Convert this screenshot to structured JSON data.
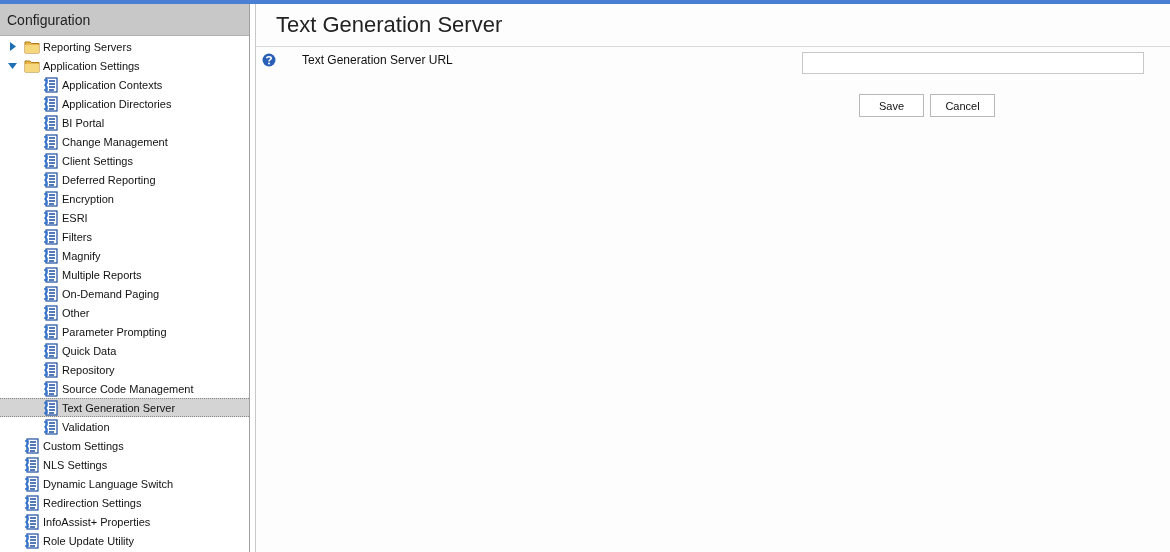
{
  "sidebar": {
    "title": "Configuration",
    "tree": [
      {
        "label": "Reporting Servers",
        "kind": "folder",
        "expanded": false,
        "selected": false
      },
      {
        "label": "Application Settings",
        "kind": "folder",
        "expanded": true,
        "selected": false,
        "children": [
          {
            "label": "Application Contexts",
            "kind": "setting",
            "selected": false
          },
          {
            "label": "Application Directories",
            "kind": "setting",
            "selected": false
          },
          {
            "label": "BI Portal",
            "kind": "setting",
            "selected": false
          },
          {
            "label": "Change Management",
            "kind": "setting",
            "selected": false
          },
          {
            "label": "Client Settings",
            "kind": "setting",
            "selected": false
          },
          {
            "label": "Deferred Reporting",
            "kind": "setting",
            "selected": false
          },
          {
            "label": "Encryption",
            "kind": "setting",
            "selected": false
          },
          {
            "label": "ESRI",
            "kind": "setting",
            "selected": false
          },
          {
            "label": "Filters",
            "kind": "setting",
            "selected": false
          },
          {
            "label": "Magnify",
            "kind": "setting",
            "selected": false
          },
          {
            "label": "Multiple Reports",
            "kind": "setting",
            "selected": false
          },
          {
            "label": "On-Demand Paging",
            "kind": "setting",
            "selected": false
          },
          {
            "label": "Other",
            "kind": "setting",
            "selected": false
          },
          {
            "label": "Parameter Prompting",
            "kind": "setting",
            "selected": false
          },
          {
            "label": "Quick Data",
            "kind": "setting",
            "selected": false
          },
          {
            "label": "Repository",
            "kind": "setting",
            "selected": false
          },
          {
            "label": "Source Code Management",
            "kind": "setting",
            "selected": false
          },
          {
            "label": "Text Generation Server",
            "kind": "setting",
            "selected": true
          },
          {
            "label": "Validation",
            "kind": "setting",
            "selected": false
          }
        ]
      },
      {
        "label": "Custom Settings",
        "kind": "setting",
        "selected": false
      },
      {
        "label": "NLS Settings",
        "kind": "setting",
        "selected": false
      },
      {
        "label": "Dynamic Language Switch",
        "kind": "setting",
        "selected": false
      },
      {
        "label": "Redirection Settings",
        "kind": "setting",
        "selected": false
      },
      {
        "label": "InfoAssist+ Properties",
        "kind": "setting",
        "selected": false
      },
      {
        "label": "Role Update Utility",
        "kind": "setting",
        "selected": false
      }
    ]
  },
  "page": {
    "title": "Text Generation Server",
    "fields": [
      {
        "label": "Text Generation Server URL"
      }
    ],
    "buttons": [
      "Save",
      "Cancel"
    ]
  }
}
